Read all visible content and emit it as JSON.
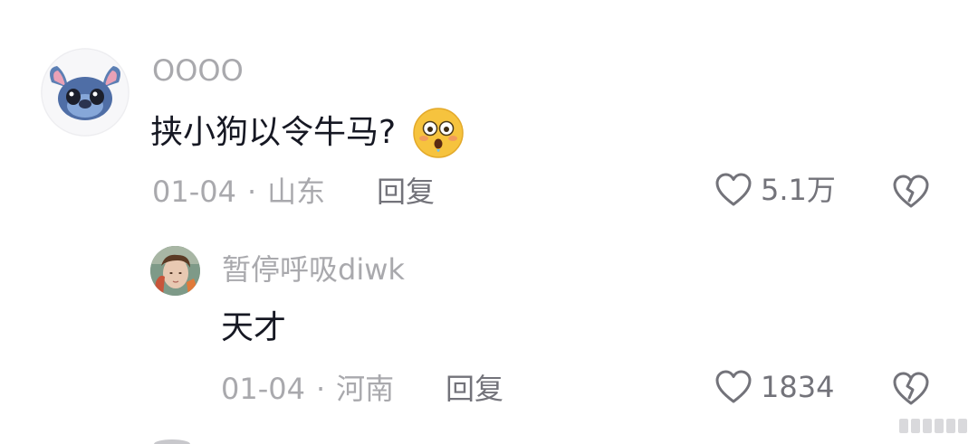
{
  "comments": [
    {
      "username": "OOOO",
      "text": "挟小狗以令牛马?",
      "emoji": "😳",
      "date": "01-04",
      "separator": "·",
      "location": "山东",
      "reply_label": "回复",
      "like_count": "5.1万"
    },
    {
      "username": "暂停呼吸diwk",
      "text": "天才",
      "date": "01-04",
      "separator": "·",
      "location": "河南",
      "reply_label": "回复",
      "like_count": "1834"
    }
  ],
  "icons": {
    "like": "heart-outline-icon",
    "dislike": "broken-heart-icon"
  },
  "colors": {
    "text_primary": "#161823",
    "text_secondary": "#a9a9ad",
    "text_action": "#73737a"
  }
}
